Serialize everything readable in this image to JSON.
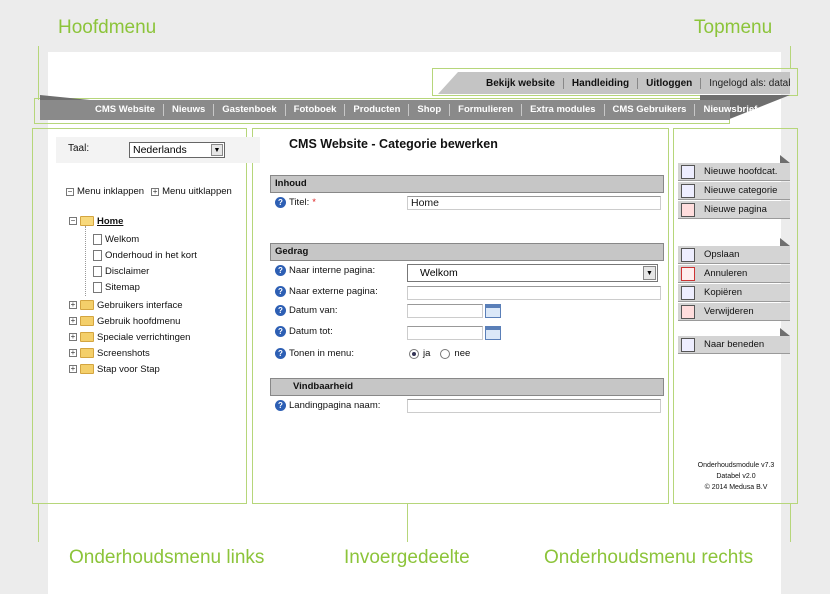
{
  "annotations": {
    "hoofdmenu": "Hoofdmenu",
    "topmenu": "Topmenu",
    "left": "Onderhoudsmenu links",
    "center": "Invoergedeelte",
    "right": "Onderhoudsmenu rechts"
  },
  "topmenu": {
    "items": [
      "Bekijk website",
      "Handleiding",
      "Uitloggen"
    ],
    "login": "Ingelogd als: databel"
  },
  "mainmenu": {
    "items": [
      "CMS Website",
      "Nieuws",
      "Gastenboek",
      "Fotoboek",
      "Producten",
      "Shop",
      "Formulieren",
      "Extra modules",
      "CMS Gebruikers",
      "Nieuwsbrief"
    ]
  },
  "left": {
    "taal_label": "Taal:",
    "taal_value": "Nederlands",
    "collapse": "Menu inklappen",
    "expand": "Menu uitklappen",
    "tree": {
      "home": "Home",
      "children": [
        "Welkom",
        "Onderhoud in het kort",
        "Disclaimer",
        "Sitemap"
      ],
      "folders": [
        "Gebruikers interface",
        "Gebruik hoofdmenu",
        "Speciale verrichtingen",
        "Screenshots",
        "Stap voor Stap"
      ]
    }
  },
  "center": {
    "title": "CMS Website - Categorie bewerken",
    "sections": {
      "inhoud": "Inhoud",
      "gedrag": "Gedrag",
      "vindbaarheid": "Vindbaarheid"
    },
    "fields": {
      "titel_label": "Titel:",
      "titel_value": "Home",
      "interne_label": "Naar interne pagina:",
      "interne_value": "Welkom",
      "externe_label": "Naar externe pagina:",
      "datum_van_label": "Datum van:",
      "datum_tot_label": "Datum tot:",
      "tonen_label": "Tonen in menu:",
      "tonen_ja": "ja",
      "tonen_nee": "nee",
      "landing_label": "Landingpagina naam:"
    }
  },
  "right": {
    "group1": [
      "Nieuwe hoofdcat.",
      "Nieuwe categorie",
      "Nieuwe pagina"
    ],
    "group2": [
      "Opslaan",
      "Annuleren",
      "Kopiëren",
      "Verwijderen"
    ],
    "group3": [
      "Naar beneden"
    ],
    "footer": [
      "Onderhoudsmodule v7.3",
      "Databel v2.0",
      "© 2014 Medusa B.V"
    ]
  }
}
